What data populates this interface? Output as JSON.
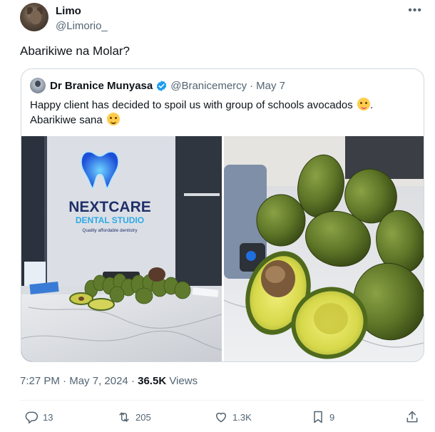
{
  "author": {
    "name": "Limo",
    "handle": "@Limorio_"
  },
  "tweet": {
    "text": "Abarikiwe na Molar?"
  },
  "quote": {
    "name": "Dr Branice Munyasa",
    "handle": "@Branicemercy",
    "separator": "·",
    "date": "May 7",
    "line1": "Happy client has decided to spoil us with group of schools avocados",
    "line1_end": ".",
    "line2": "Abarikiwe sana",
    "sign_brand": "NEXTCARE",
    "sign_sub": "DENTAL STUDIO",
    "sign_tagline": "Quality affordable dentistry"
  },
  "meta": {
    "time": "7:27 PM",
    "sep1": "·",
    "date": "May 7, 2024",
    "sep2": "·",
    "views_count": "36.5K",
    "views_label": "Views"
  },
  "actions": {
    "replies": "13",
    "reposts": "205",
    "likes": "1.3K",
    "bookmarks": "9"
  },
  "icons": {
    "more": "more-icon",
    "verified": "verified-badge-icon",
    "reply": "reply-icon",
    "repost": "repost-icon",
    "like": "heart-icon",
    "bookmark": "bookmark-icon",
    "share": "share-icon"
  },
  "colors": {
    "text": "#0f1419",
    "secondary": "#536471",
    "verified": "#1d9bf0",
    "border": "#cfd9de"
  }
}
